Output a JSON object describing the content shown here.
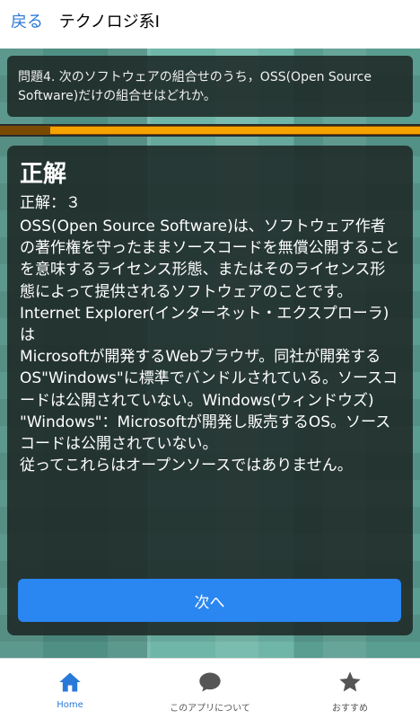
{
  "header": {
    "back_label": "戻る",
    "title": "テクノロジ系I"
  },
  "question": {
    "text": "問題4. 次のソフトウェアの組合せのうち，OSS(Open Source Software)だけの組合せはどれか。"
  },
  "progress": {
    "fraction": 0.88
  },
  "result": {
    "verdict": "正解",
    "answer_line": "正解：３",
    "explanation": [
      "OSS(Open Source Software)は、ソフトウェア作者の著作権を守ったままソースコードを無償公開することを意味するライセンス形態、またはそのライセンス形態によって提供されるソフトウェアのことです。",
      "Internet Explorer(インターネット・エクスプローラ)は",
      "Microsoftが開発するWebブラウザ。同社が開発するOS\"Windows\"に標準でバンドルされている。ソースコードは公開されていない。Windows(ウィンドウズ)",
      "\"Windows\"：Microsoftが開発し販売するOS。ソースコードは公開されていない。",
      "従ってこれらはオープンソースではありません。"
    ],
    "next_label": "次へ"
  },
  "tabs": [
    {
      "label": "Home",
      "icon": "home-icon",
      "active": true
    },
    {
      "label": "このアプリについて",
      "icon": "chat-bubble-icon",
      "active": false
    },
    {
      "label": "おすすめ",
      "icon": "star-icon",
      "active": false
    }
  ],
  "colors": {
    "accent": "#2979d9",
    "button": "#2a86f0",
    "progress": "#f5a300"
  }
}
